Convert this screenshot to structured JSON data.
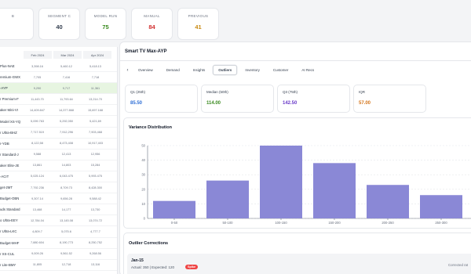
{
  "colors": {
    "bar": "#8a88d6",
    "pink": "#d4537e",
    "green": "#3a8a1f",
    "red": "#d12d2d",
    "amber": "#c98a12",
    "blue": "#2f6fd6",
    "purple": "#6a3bc9",
    "orange": "#d4751b"
  },
  "stats": [
    {
      "label": "B",
      "value": ""
    },
    {
      "label": "SEGMENT C",
      "value": "40"
    },
    {
      "label": "MODEL RUN",
      "value": "75"
    },
    {
      "label": "MANUAL",
      "value": "84"
    },
    {
      "label": "PREVIOUS",
      "value": "41"
    }
  ],
  "table": {
    "columns": [
      "Feb 2024",
      "Mar 2024",
      "Apr 2024"
    ],
    "rows": [
      {
        "name": "Plus-NAE",
        "c": [
          "3,398.16",
          "5,460.12",
          "5,418.13"
        ],
        "sel": false
      },
      {
        "name": "remium-GWX",
        "c": [
          "7,705",
          "7,416",
          "7,718"
        ],
        "sel": false
      },
      {
        "name": "-AYP",
        "c": [
          "9,290",
          "9,717",
          "11,361"
        ],
        "sel": true
      },
      {
        "name": "r Premium-F",
        "c": [
          "11,443.70",
          "11,793.64",
          "13,214.70"
        ],
        "sel": false
      },
      {
        "name": "aker Mini-VI",
        "c": [
          "14,409.847",
          "14,377.868",
          "15,697.168"
        ],
        "sel": false
      },
      {
        "name": "Model XS-YQ",
        "c": [
          "5,099.763",
          "5,292,050",
          "5,421,69"
        ],
        "sel": false
      },
      {
        "name": "r Ultra-BHZ",
        "c": [
          "7,717.519",
          "7,912,296",
          "7,903,468"
        ],
        "sel": false
      },
      {
        "name": "r-YDB",
        "c": [
          "8,122,58",
          "8,473,408",
          "10,917,403"
        ],
        "sel": false
      },
      {
        "name": "r Standard-J",
        "c": [
          "9,588",
          "12,413",
          "12,956"
        ],
        "sel": false
      },
      {
        "name": "aker Elite-JE",
        "c": [
          "13,861",
          "14,803",
          "15,284"
        ],
        "sel": false
      },
      {
        "name": "-ACIT",
        "c": [
          "5,025.124",
          "6,043.475",
          "5,993.475"
        ],
        "sel": false
      },
      {
        "name": "get-2MT",
        "c": [
          "7,792.236",
          "8,709.73",
          "8,428.300"
        ],
        "sel": false
      },
      {
        "name": "Budget-OBN",
        "c": [
          "9,307.14",
          "9,656.28",
          "9,588.42"
        ],
        "sel": false
      },
      {
        "name": "uds Standard",
        "c": [
          "13,468",
          "14,177",
          "13,730"
        ],
        "sel": false
      },
      {
        "name": "o Ultra-EEY",
        "c": [
          "12,784.04",
          "13,145.08",
          "13,074.72"
        ],
        "sel": false
      },
      {
        "name": "r Ultra-LKC",
        "c": [
          "4,809.7",
          "5,075.6",
          "4,777.7"
        ],
        "sel": false
      },
      {
        "name": "Budget-MHF",
        "c": [
          "7,880.604",
          "8,190,773",
          "8,250,752"
        ],
        "sel": false
      },
      {
        "name": "r XS-CUL",
        "c": [
          "9,009.26",
          "9,561.52",
          "9,268.56"
        ],
        "sel": false
      },
      {
        "name": "r Lite-BMY",
        "c": [
          "11,805",
          "12,718",
          "13,116"
        ],
        "sel": false
      },
      {
        "name": "ker Pro-AEX",
        "c": [
          "14,057,160",
          "14,693,441",
          "14,611,861"
        ],
        "sel": false
      }
    ]
  },
  "panel": {
    "title": "Smart TV Max-AYP",
    "tabs": [
      "Overview",
      "Demand",
      "Insights",
      "Outliers",
      "Inventory",
      "Customer",
      "AI Recs"
    ],
    "active_tab": "Outliers",
    "quartiles": [
      {
        "label": "Q1 (25th)",
        "value": "85.50",
        "color": "#2f6fd6"
      },
      {
        "label": "Median (50th)",
        "value": "114.00",
        "color": "#3a8a1f"
      },
      {
        "label": "Q3 (75th)",
        "value": "142.50",
        "color": "#6a3bc9"
      },
      {
        "label": "IQR",
        "value": "57.00",
        "color": "#d4751b"
      }
    ]
  },
  "chart_data": {
    "type": "bar",
    "title": "Variance Distribution",
    "categories": [
      "0-50",
      "50-100",
      "100-150",
      "150-200",
      "200-250",
      "250-300"
    ],
    "values": [
      12,
      26,
      50,
      38,
      23,
      16
    ],
    "extra_bar_partial": 9,
    "yticks": [
      0,
      10,
      20,
      30,
      40,
      50
    ],
    "ylim": [
      0,
      50
    ]
  },
  "corrections": {
    "title": "Outlier Corrections",
    "items": [
      {
        "date": "Jan-15",
        "detail": "Actual: 350 | Expected: 120",
        "badge": "Spike",
        "status": "Corrected rat"
      }
    ]
  }
}
